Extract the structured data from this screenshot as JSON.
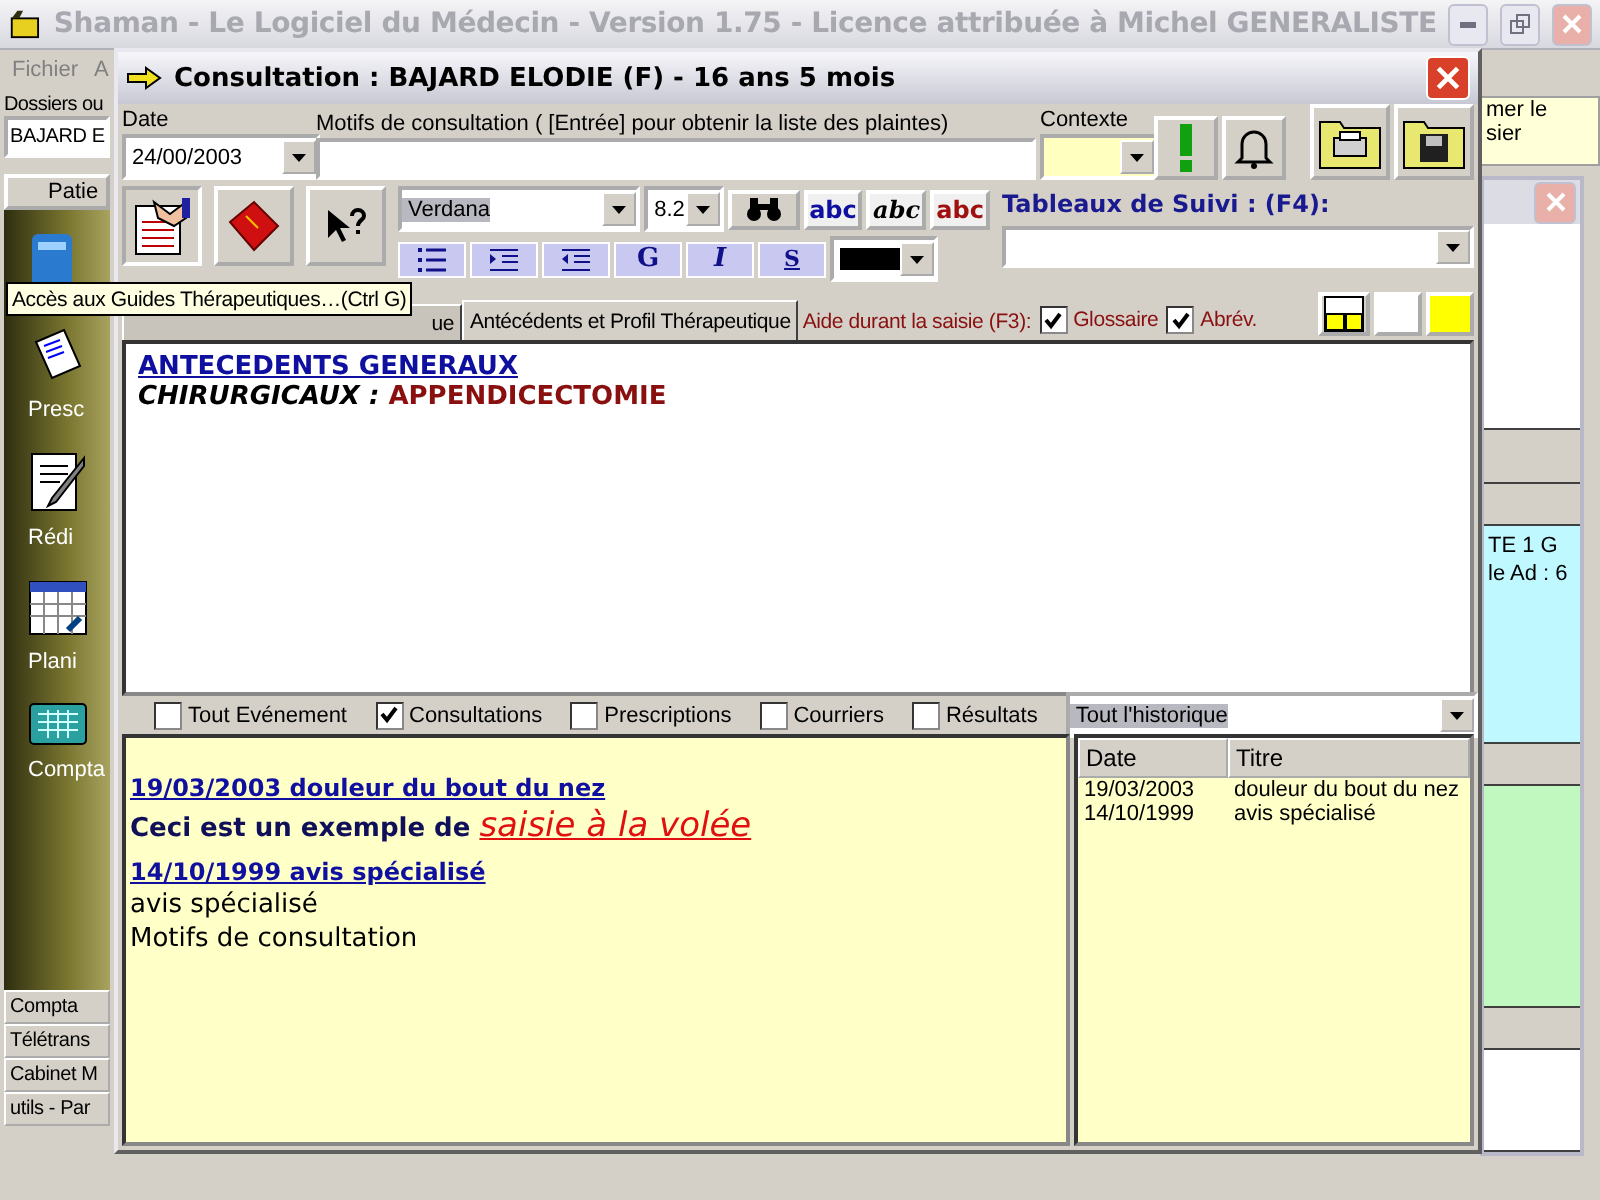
{
  "main_window": {
    "title": "Shaman - Le Logiciel du Médecin - Version 1.75 - Licence attribuée à Michel GENERALISTE",
    "menu": [
      "Fichier",
      "A"
    ],
    "sidebar": {
      "search_label": "Dossiers ou",
      "search_value": "BAJARD E",
      "header": "Patie",
      "launchers": [
        {
          "kind": "folder"
        },
        {
          "kind": "prescription",
          "label": "Presc"
        },
        {
          "kind": "letter",
          "label": "Rédi"
        },
        {
          "kind": "planning",
          "label": "Plani"
        },
        {
          "kind": "accounting",
          "label": "Compta"
        }
      ],
      "sections": [
        "Compta",
        "Télétrans",
        "Cabinet M",
        "utils - Par"
      ]
    },
    "note": [
      "mer le",
      "sier"
    ],
    "info": [
      "TE 1 G",
      "le Ad : 6"
    ]
  },
  "tooltip": "Accès aux Guides Thérapeutiques…(Ctrl G)",
  "consultation": {
    "title": "Consultation : BAJARD ELODIE (F) -  16 ans 5 mois",
    "date_label": "Date",
    "date": "24/00/2003",
    "motifs_label": "Motifs de consultation ( [Entrée]  pour obtenir la liste des plaintes)",
    "context_label": "Contexte",
    "font": "Verdana",
    "font_size": "8.2",
    "styles": [
      {
        "text": "abc",
        "kind": "bold"
      },
      {
        "text": "abc",
        "kind": "italic"
      },
      {
        "text": "abc",
        "kind": "red"
      }
    ],
    "format_buttons": [
      {
        "kind": "bullets"
      },
      {
        "kind": "indent"
      },
      {
        "kind": "outdent"
      },
      {
        "kind": "text",
        "text": "G"
      },
      {
        "kind": "text",
        "text": "I"
      },
      {
        "kind": "text",
        "text": "S"
      }
    ],
    "follow_label": "Tableaux de Suivi : (F4):",
    "tabs": [
      {
        "label": "ue",
        "selected": false
      },
      {
        "label": "Antécédents et Profil Thérapeutique",
        "selected": true
      }
    ],
    "assist_label": "Aide durant la saisie (F3):",
    "assist_options": [
      {
        "label": "Glossaire",
        "checked": true
      },
      {
        "label": "Abrév.",
        "checked": true
      }
    ],
    "editor": [
      {
        "kind": "heading",
        "parts": [
          {
            "text": "ANTECEDENTS GENERAUX",
            "kind": "heading"
          }
        ]
      },
      {
        "kind": "line",
        "parts": [
          {
            "text": "CHIRURGICAUX : ",
            "kind": "category"
          },
          {
            "text": "APPENDICECTOMIE",
            "kind": "value"
          }
        ]
      }
    ],
    "filters": [
      {
        "label": "Tout Evénement",
        "checked": false
      },
      {
        "label": "Consultations",
        "checked": true
      },
      {
        "label": "Prescriptions",
        "checked": false
      },
      {
        "label": "Courriers",
        "checked": false
      },
      {
        "label": "Résultats",
        "checked": false
      }
    ],
    "history_select": "Tout l'historique",
    "history": [
      {
        "heading": "19/03/2003 douleur du bout du nez",
        "lines": [
          [
            {
              "text": "Ceci est un exemple de ",
              "kind": "bold"
            },
            {
              "text": "saisie à la volée",
              "kind": "highlight"
            }
          ]
        ]
      },
      {
        "heading": "14/10/1999 avis spécialisé",
        "lines": [
          [
            {
              "text": "avis spécialisé",
              "kind": "plain"
            }
          ],
          [
            {
              "text": "Motifs de consultation",
              "kind": "plain"
            }
          ]
        ]
      }
    ],
    "list_columns": [
      "Date",
      "Titre"
    ],
    "list_rows": [
      [
        "19/03/2003",
        "douleur du bout du nez"
      ],
      [
        "14/10/1999",
        "avis spécialisé"
      ]
    ]
  }
}
